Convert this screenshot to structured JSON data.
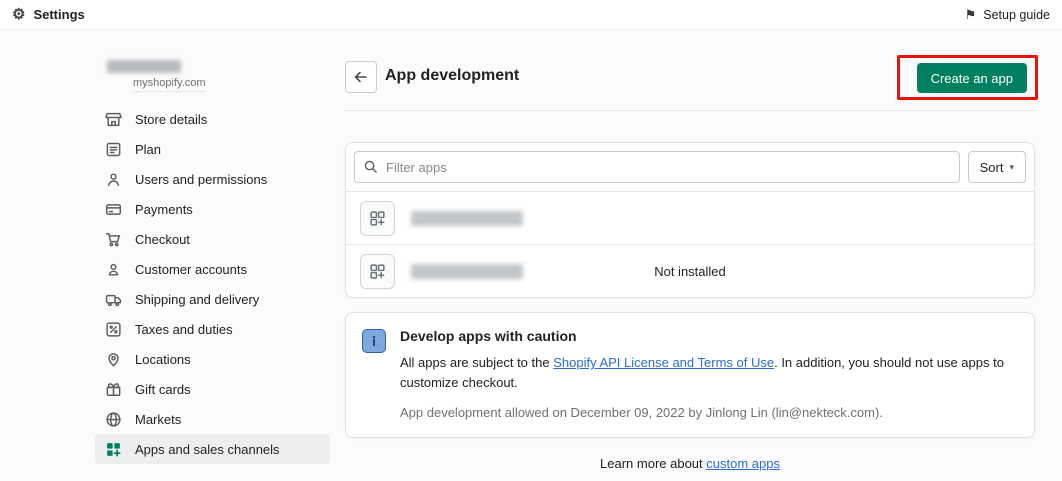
{
  "colors": {
    "accent_green": "#008060",
    "link_blue": "#2c6ecb",
    "annotation_red": "#ea120b"
  },
  "topbar": {
    "title": "Settings",
    "setup_guide": "Setup guide"
  },
  "sidebar": {
    "store_domain": "myshopify.com",
    "items": [
      {
        "label": "Store details",
        "icon": "store-icon"
      },
      {
        "label": "Plan",
        "icon": "plan-icon"
      },
      {
        "label": "Users and permissions",
        "icon": "users-icon"
      },
      {
        "label": "Payments",
        "icon": "payments-icon"
      },
      {
        "label": "Checkout",
        "icon": "checkout-icon"
      },
      {
        "label": "Customer accounts",
        "icon": "customer-accounts-icon"
      },
      {
        "label": "Shipping and delivery",
        "icon": "shipping-icon"
      },
      {
        "label": "Taxes and duties",
        "icon": "taxes-icon"
      },
      {
        "label": "Locations",
        "icon": "locations-icon"
      },
      {
        "label": "Gift cards",
        "icon": "gift-cards-icon"
      },
      {
        "label": "Markets",
        "icon": "markets-icon"
      },
      {
        "label": "Apps and sales channels",
        "icon": "apps-icon",
        "active": true
      }
    ]
  },
  "main": {
    "page_title": "App development",
    "create_button": "Create an app",
    "filter": {
      "placeholder": "Filter apps"
    },
    "sort_button": "Sort",
    "app_rows": [
      {
        "status": ""
      },
      {
        "status": "Not installed"
      }
    ],
    "banner": {
      "title": "Develop apps with caution",
      "body_pre": "All apps are subject to the ",
      "body_link": "Shopify API License and Terms of Use",
      "body_post": ". In addition, you should not use apps to customize checkout.",
      "note": "App development allowed on December 09, 2022 by Jinlong Lin (lin@nekteck.com)."
    },
    "footer": {
      "pre": "Learn more about ",
      "link": "custom apps"
    }
  }
}
